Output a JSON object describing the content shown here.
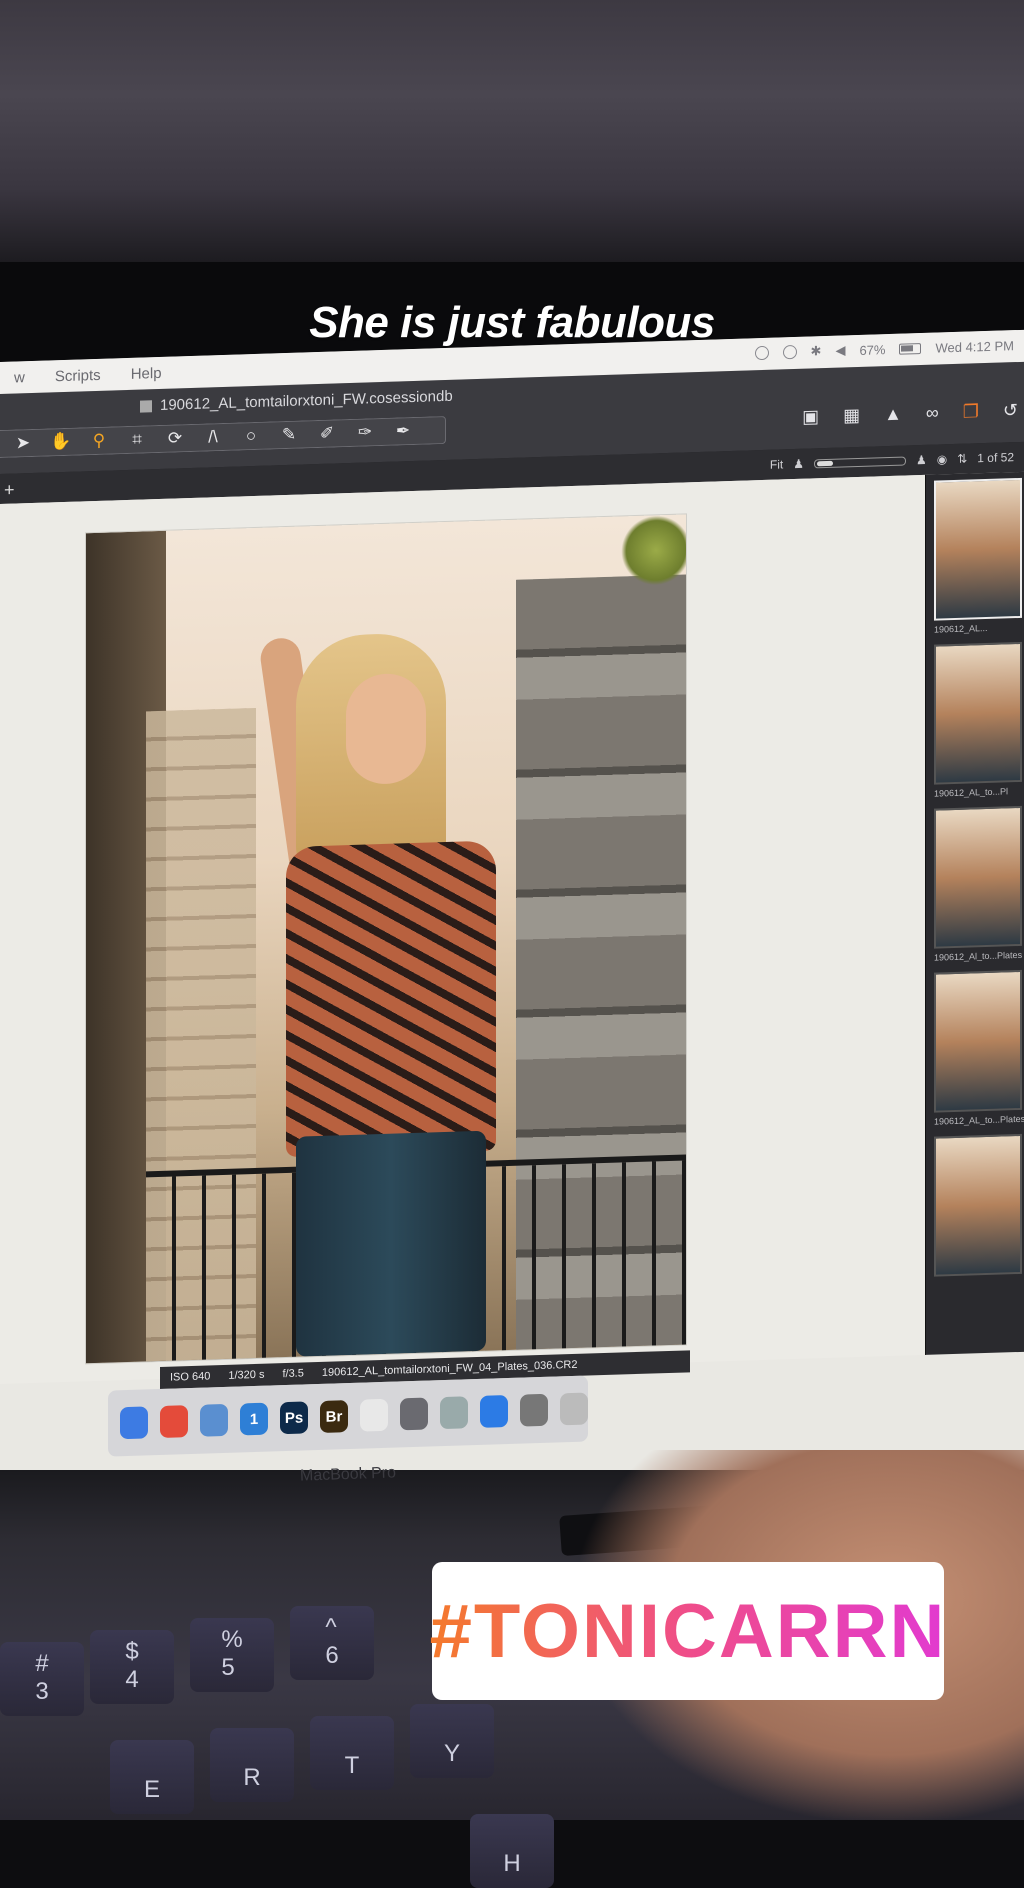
{
  "story": {
    "caption": "She is just fabulous",
    "hashtag": "#TONICARRN"
  },
  "menubar": {
    "items": [
      "w",
      "Scripts",
      "Help"
    ],
    "battery": "67%",
    "clock": "Wed 4:12 PM"
  },
  "window": {
    "title": "190612_AL_tomtailorxtoni_FW.cosessiondb"
  },
  "tools": {
    "icons": [
      "pointer-icon",
      "hand-icon",
      "zoom-icon",
      "crop-icon",
      "rotate-icon",
      "keystone-icon",
      "circle-mask-icon",
      "brush-icon",
      "erase-icon",
      "gradient-icon",
      "annotate-icon"
    ]
  },
  "viewbar": {
    "fit": "Fit",
    "count": "1 of 52"
  },
  "photo_info": {
    "iso": "ISO 640",
    "shutter": "1/320 s",
    "aperture": "f/3.5",
    "filename": "190612_AL_tomtailorxtoni_FW_04_Plates_036.CR2"
  },
  "filmstrip": {
    "labels": [
      "190612_AL...",
      "190612_AL_to...Pl",
      "190612_Al_to...Plates",
      "190612_AL_to...Plates_0"
    ]
  },
  "dock": {
    "apps": [
      {
        "label": "",
        "color": "#3d7be3"
      },
      {
        "label": "",
        "color": "#e44b3a"
      },
      {
        "label": "",
        "color": "#5a8fd0"
      },
      {
        "label": "1",
        "color": "#2e7fd6"
      },
      {
        "label": "Ps",
        "color": "#0d2a4a"
      },
      {
        "label": "Br",
        "color": "#3b2a10"
      },
      {
        "label": "",
        "color": "#e8e8e8"
      },
      {
        "label": "",
        "color": "#6a6a70"
      },
      {
        "label": "",
        "color": "#9aa"
      },
      {
        "label": "",
        "color": "#2c7be5"
      },
      {
        "label": "",
        "color": "#777"
      },
      {
        "label": "",
        "color": "#bbb"
      }
    ]
  },
  "keyboard": {
    "keys": [
      "#\n3",
      "$\n4",
      "%\n5",
      "^\n6",
      "E",
      "R",
      "T",
      "Y",
      "H"
    ]
  },
  "chassis_label": "MacBook Pro"
}
